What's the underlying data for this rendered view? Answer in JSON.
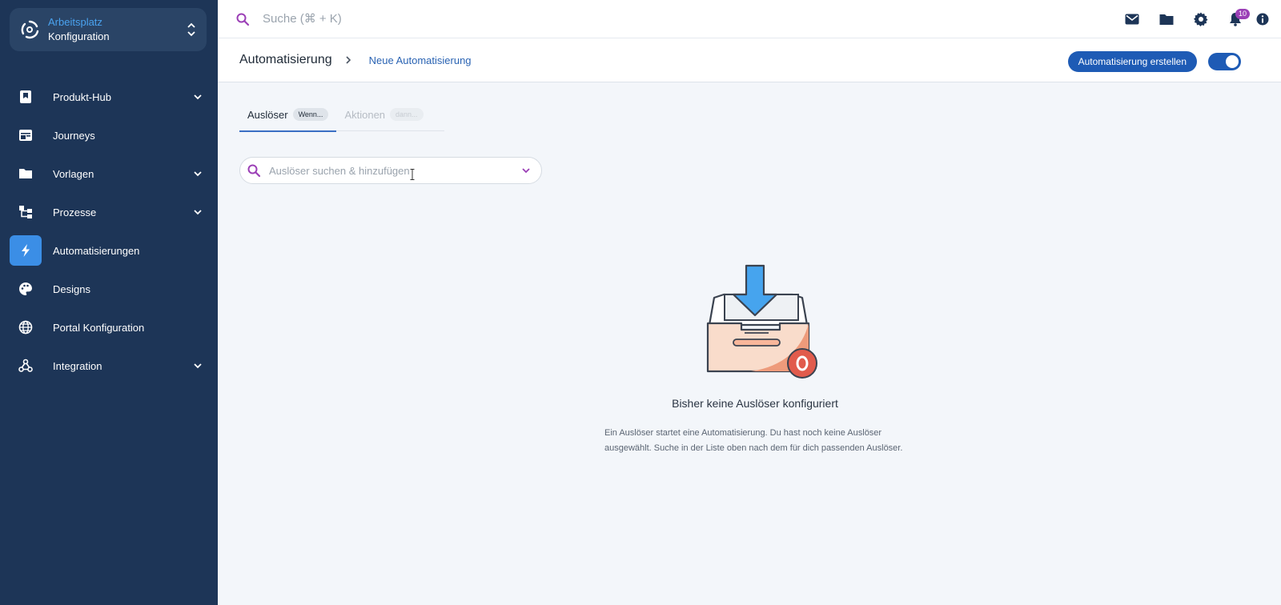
{
  "workspace": {
    "top_label": "Arbeitsplatz",
    "bottom_label": "Konfiguration"
  },
  "sidebar": {
    "items": [
      {
        "label": "Produkt-Hub",
        "icon": "product-hub-icon",
        "has_chevron": true
      },
      {
        "label": "Journeys",
        "icon": "journeys-icon",
        "has_chevron": false
      },
      {
        "label": "Vorlagen",
        "icon": "folder-icon",
        "has_chevron": true
      },
      {
        "label": "Prozesse",
        "icon": "process-icon",
        "has_chevron": true
      },
      {
        "label": "Automatisierungen",
        "icon": "lightning-icon",
        "has_chevron": false,
        "active": true
      },
      {
        "label": "Designs",
        "icon": "palette-icon",
        "has_chevron": false
      },
      {
        "label": "Portal Konfiguration",
        "icon": "globe-icon",
        "has_chevron": false
      },
      {
        "label": "Integration",
        "icon": "webhook-icon",
        "has_chevron": true
      }
    ]
  },
  "topbar": {
    "search_placeholder": "Suche (⌘ + K)",
    "notifications_count": "10",
    "icons": [
      "mail-icon",
      "folder-icon",
      "gear-icon",
      "bell-icon",
      "info-icon"
    ]
  },
  "header": {
    "title": "Automatisierung",
    "breadcrumb": "Neue Automatisierung",
    "create_button": "Automatisierung erstellen",
    "toggle_on": true
  },
  "tabs": [
    {
      "label": "Auslöser",
      "chip": "Wenn...",
      "active": true
    },
    {
      "label": "Aktionen",
      "chip": "dann...",
      "active": false
    }
  ],
  "trigger_search": {
    "placeholder": "Auslöser suchen & hinzufügen"
  },
  "empty_state": {
    "title": "Bisher keine Auslöser konfiguriert",
    "description": "Ein Auslöser startet eine Automatisierung. Du hast noch keine Auslöser ausgewählt. Suche in der Liste oben nach dem für dich passenden Auslöser."
  },
  "colors": {
    "sidebar_bg": "#1d3557",
    "accent": "#1e5bb5",
    "active_nav": "#3b8ee6",
    "badge": "#9b3fb6",
    "search_icon": "#9b3fb6"
  }
}
